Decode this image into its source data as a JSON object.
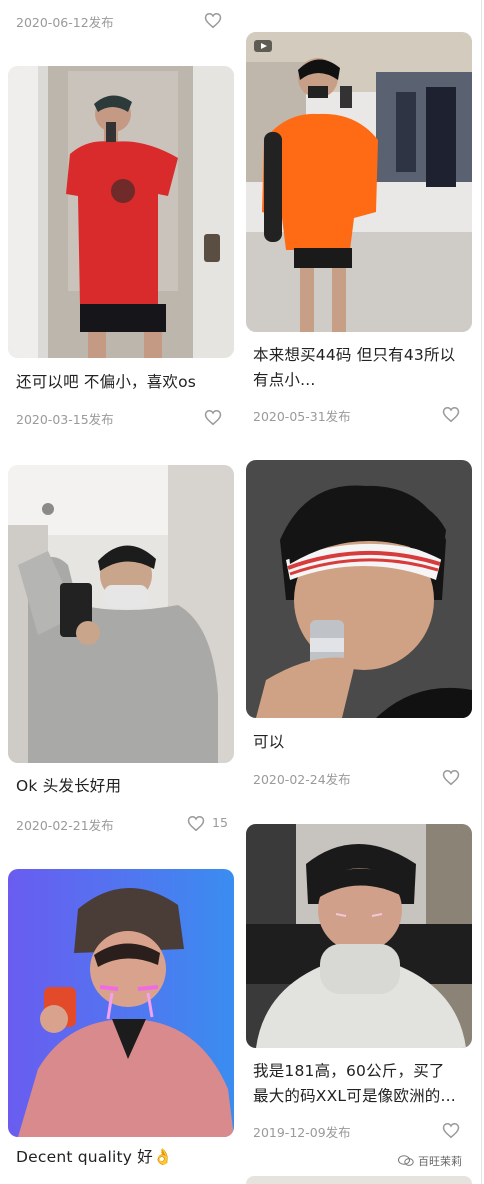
{
  "feed": {
    "top_date": "2020-06-12发布",
    "left": [
      {
        "caption": "还可以吧 不偏小，喜欢os",
        "date": "2020-03-15发布"
      },
      {
        "caption": "Ok 头发长好用",
        "date": "2020-02-21发布",
        "likes": "15"
      },
      {
        "caption": "Decent quality 好👌"
      }
    ],
    "right": [
      {
        "caption_line1": "本来想买44码 但只有43所以",
        "caption_line2": "有点小...",
        "date": "2020-05-31发布"
      },
      {
        "caption": "可以",
        "date": "2020-02-24发布"
      },
      {
        "caption_line1": "我是181高，60公斤，买了",
        "caption_line2": "最大的码XXL可是像欧洲的...",
        "date": "2019-12-09发布"
      }
    ]
  },
  "watermark": {
    "text": "百旺茉莉"
  },
  "icons": {
    "like": "heart-outline-icon",
    "video": "play-icon",
    "watermark": "wechat-icon"
  },
  "colors": {
    "text": "#222222",
    "meta": "#9a9a9a",
    "background": "#ffffff"
  }
}
